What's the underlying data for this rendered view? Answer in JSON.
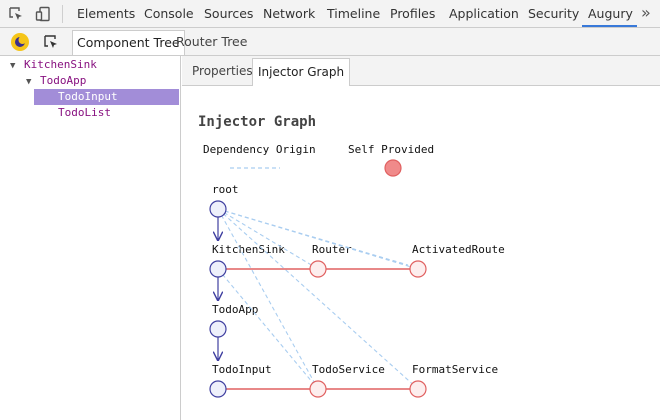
{
  "devtools_tabs": [
    {
      "label": "Elements"
    },
    {
      "label": "Console"
    },
    {
      "label": "Sources"
    },
    {
      "label": "Network"
    },
    {
      "label": "Timeline"
    },
    {
      "label": "Profiles"
    },
    {
      "label": "Application"
    },
    {
      "label": "Security"
    },
    {
      "label": "Augury",
      "active": true
    }
  ],
  "more_label": "»",
  "augury_tabs": [
    {
      "label": "Component Tree",
      "active": true
    },
    {
      "label": "Router Tree"
    }
  ],
  "tree": [
    {
      "label": "KitchenSink",
      "expanded": true,
      "depth": 0
    },
    {
      "label": "TodoApp",
      "expanded": true,
      "depth": 1
    },
    {
      "label": "TodoInput",
      "selected": true,
      "depth": 2
    },
    {
      "label": "TodoList",
      "depth": 2
    }
  ],
  "detail_tabs": [
    {
      "label": "Properties"
    },
    {
      "label": "Injector Graph",
      "active": true
    }
  ],
  "graph": {
    "title": "Injector Graph",
    "legend": {
      "dependency_origin": "Dependency Origin",
      "self_provided": "Self Provided"
    },
    "nodes": {
      "root": "root",
      "kitchen_sink": "KitchenSink",
      "router": "Router",
      "activated_route": "ActivatedRoute",
      "todo_app": "TodoApp",
      "todo_input": "TodoInput",
      "todo_service": "TodoService",
      "format_service": "FormatService"
    }
  },
  "colors": {
    "injector_node": "#3f3fa0",
    "provider_node": "#e06060",
    "dependency_line": "#a9cdf0",
    "selected_row": "#a28dd8",
    "active_tab_underline": "#3879d9"
  }
}
